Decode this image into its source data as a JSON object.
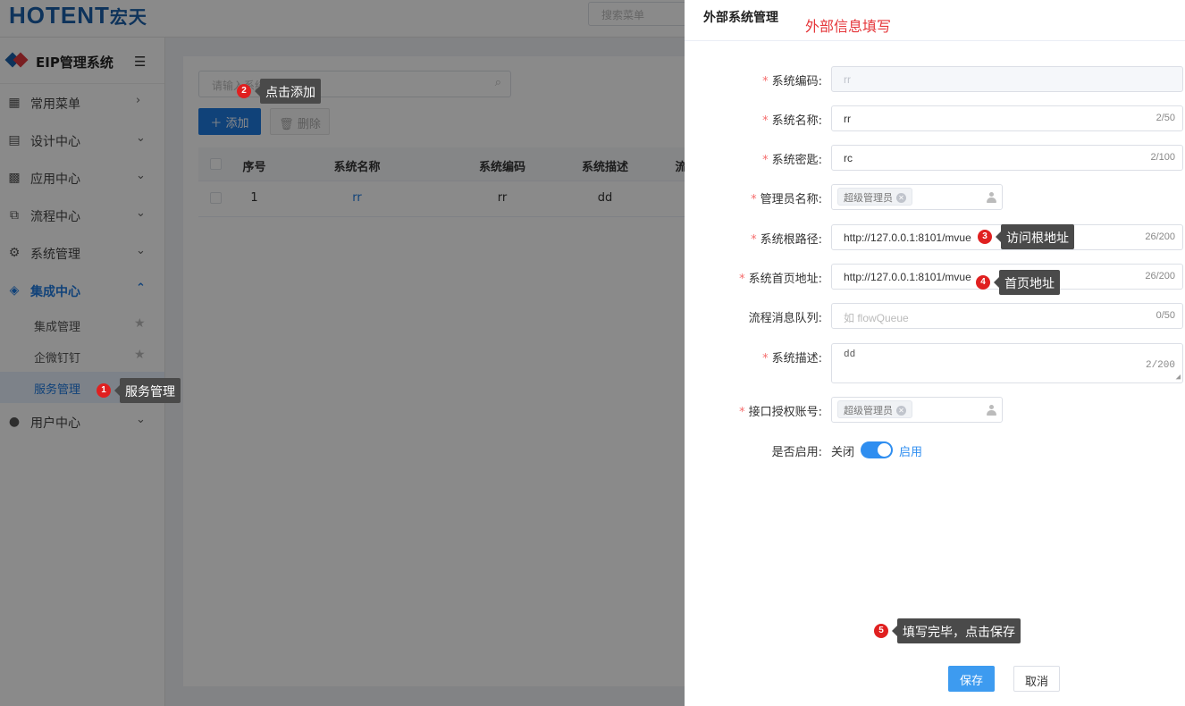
{
  "app": {
    "logo_text": "HOTENT",
    "logo_cn": "宏天",
    "brand_title": "EIP管理系统",
    "menu_search_placeholder": "搜索菜单"
  },
  "sidebar": {
    "items": [
      {
        "label": "常用菜单",
        "icon": "grid-icon",
        "chevron": "›"
      },
      {
        "label": "设计中心",
        "icon": "design-icon",
        "chevron": "⌄"
      },
      {
        "label": "应用中心",
        "icon": "apps-icon",
        "chevron": "⌄"
      },
      {
        "label": "流程中心",
        "icon": "flow-icon",
        "chevron": "⌄"
      },
      {
        "label": "系统管理",
        "icon": "gear-icon",
        "chevron": "⌄"
      },
      {
        "label": "集成中心",
        "icon": "layers-icon",
        "chevron": "⌃"
      },
      {
        "label": "用户中心",
        "icon": "user-icon",
        "chevron": "⌄"
      }
    ],
    "sub_items": [
      {
        "label": "集成管理"
      },
      {
        "label": "企微钉钉"
      },
      {
        "label": "服务管理"
      }
    ]
  },
  "list": {
    "search_placeholder": "请输入系统",
    "add_button": "＋ 添加",
    "delete_button": "删除",
    "columns": [
      "序号",
      "系统名称",
      "系统编码",
      "系统描述",
      "流"
    ],
    "rows": [
      {
        "index": "1",
        "name": "rr",
        "code": "rr",
        "desc": "dd"
      }
    ]
  },
  "drawer": {
    "title": "外部系统管理",
    "hint": "外部信息填写",
    "fields": {
      "code": {
        "label": "系统编码:",
        "value": "rr"
      },
      "name": {
        "label": "系统名称:",
        "value": "rr",
        "count": "2/50"
      },
      "secret": {
        "label": "系统密匙:",
        "value": "rc",
        "count": "2/100"
      },
      "admin": {
        "label": "管理员名称:",
        "tag": "超级管理员"
      },
      "root_path": {
        "label": "系统根路径:",
        "value": "http://127.0.0.1:8101/mvue",
        "count": "26/200"
      },
      "home_url": {
        "label": "系统首页地址:",
        "value": "http://127.0.0.1:8101/mvue",
        "count": "26/200"
      },
      "queue": {
        "label": "流程消息队列:",
        "placeholder": "如  flowQueue",
        "count": "0/50"
      },
      "desc": {
        "label": "系统描述:",
        "value": "dd",
        "count": "2/200"
      },
      "api_account": {
        "label": "接口授权账号:",
        "tag": "超级管理员"
      },
      "enabled": {
        "label": "是否启用:",
        "off_text": "关闭",
        "on_text": "启用",
        "value": true
      }
    },
    "save_button": "保存",
    "cancel_button": "取消"
  },
  "callouts": [
    {
      "num": "1",
      "text": "服务管理"
    },
    {
      "num": "2",
      "text": "点击添加"
    },
    {
      "num": "3",
      "text": "访问根地址"
    },
    {
      "num": "4",
      "text": "首页地址"
    },
    {
      "num": "5",
      "text": "填写完毕，点击保存"
    }
  ],
  "colors": {
    "accent": "#1f7ae0",
    "required": "#f56c6c",
    "hint_red": "#e5363a",
    "callout_badge": "#e02020",
    "callout_bg": "#4a4a4a"
  }
}
